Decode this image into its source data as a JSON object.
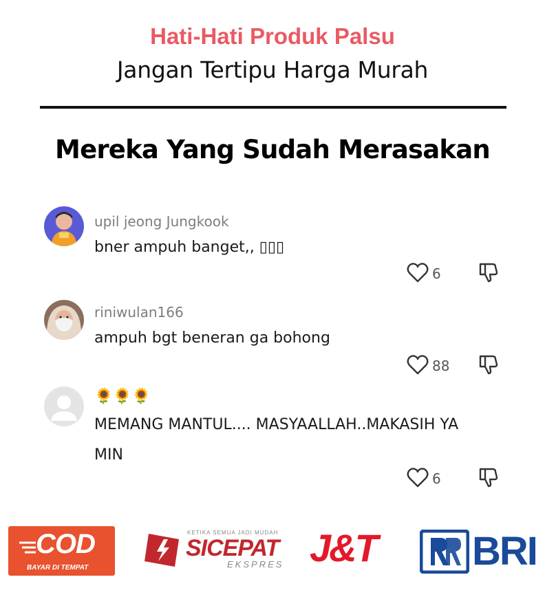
{
  "header": {
    "warning_title": "Hati-Hati Produk Palsu",
    "subtitle": "Jangan Tertipu Harga Murah"
  },
  "section": {
    "title": "Mereka Yang Sudah Merasakan"
  },
  "comments": [
    {
      "username": "upil jeong Jungkook",
      "text": "bner ampuh banget,, ▯▯▯",
      "likes": "6"
    },
    {
      "username": "riniwulan166",
      "text": "ampuh bgt beneran ga bohong",
      "likes": "88"
    },
    {
      "username": "🌻🌻🌻",
      "text": "MEMANG MANTUL.... MASYAALLAH..MAKASIH YA MIN",
      "likes": "6"
    }
  ],
  "logos": {
    "cod": {
      "main": "COD",
      "sub": "BAYAR DI TEMPAT",
      "color": "#e8522f"
    },
    "sicepat": {
      "tagline": "KETIKA SEMUA JADI MUDAH",
      "name": "SICEPAT",
      "sub": "EKSPRES",
      "color": "#c1272d"
    },
    "jnt": {
      "name": "J&T",
      "color": "#e3192a"
    },
    "bri": {
      "name": "BRI",
      "color": "#1a4a9a"
    }
  },
  "colors": {
    "warning": "#e95a63",
    "text": "#111111",
    "muted": "#7d7d7d"
  },
  "icons": {
    "like": "heart-outline-icon",
    "dislike": "thumbs-down-icon"
  }
}
